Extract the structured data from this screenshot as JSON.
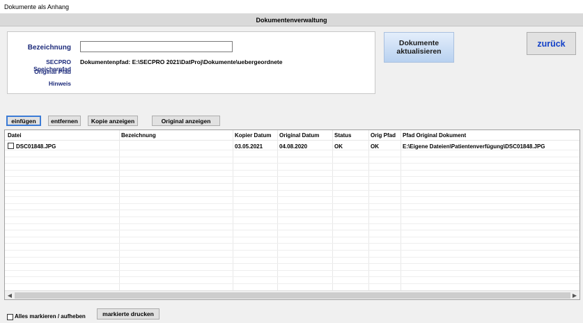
{
  "window": {
    "title": "Dokumente als Anhang"
  },
  "header": {
    "title": "Dokumentenverwaltung"
  },
  "form": {
    "bezeichnung_label": "Bezeichnung",
    "bezeichnung_value": "",
    "speicherpfad_label": "SECPRO Speicherpfad",
    "dokumentenpfad_text": "Dokumentenpfad:  E:\\SECPRO 2021\\DatProj\\Dokumente\\uebergeordnete",
    "original_pfad_label": "Original Pfad",
    "hinweis_label": "Hinweis"
  },
  "buttons": {
    "aktualisieren_line1": "Dokumente",
    "aktualisieren_line2": "aktualisieren",
    "zurueck": "zurück",
    "einfuegen": "einfügen",
    "entfernen": "entfernen",
    "kopie_anzeigen": "Kopie anzeigen",
    "original_anzeigen": "Original anzeigen",
    "markierte_drucken": "markierte drucken"
  },
  "table": {
    "columns": [
      "Datei",
      "Bezeichnung",
      "Kopier Datum",
      "Original Datum",
      "Status",
      "Orig Pfad",
      "Pfad  Original Dokument"
    ],
    "rows": [
      {
        "datei": "DSC01848.JPG",
        "bezeichnung": "",
        "kopier_datum": "03.05.2021",
        "original_datum": "04.08.2020",
        "status": "OK",
        "orig_pfad": "OK",
        "pfad_original": "E:\\Eigene Dateien\\Patientenverfügung\\DSC01848.JPG",
        "checked": false
      }
    ]
  },
  "footer": {
    "select_all_label": "Alles markieren / aufheben",
    "select_all_checked": false
  },
  "icons": {
    "scroll_left": "chevron-left-icon",
    "scroll_right": "chevron-right-icon"
  }
}
